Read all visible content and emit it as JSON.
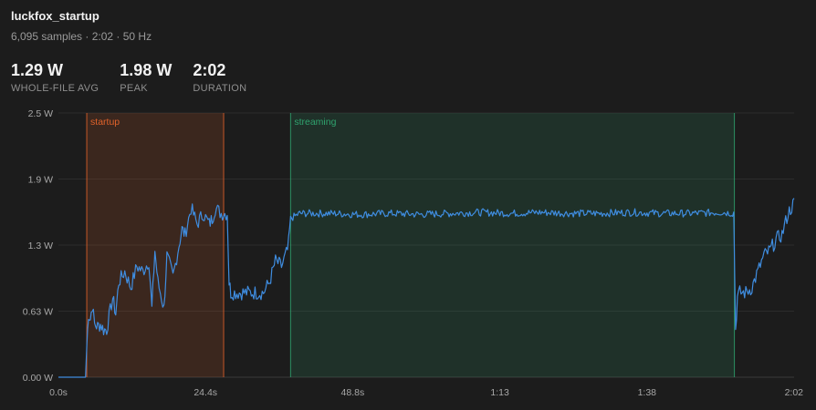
{
  "header": {
    "title": "luckfox_startup",
    "subtitle": "6,095 samples · 2:02 · 50 Hz"
  },
  "stats": [
    {
      "value": "1.29 W",
      "label": "WHOLE-FILE AVG"
    },
    {
      "value": "1.98 W",
      "label": "PEAK"
    },
    {
      "value": "2:02",
      "label": "DURATION"
    }
  ],
  "colors": {
    "line": "#3f8de0",
    "startup": "#e0622a",
    "streaming": "#2fa36e",
    "grid": "#2c2c2c",
    "background": "#1c1c1c"
  },
  "chart_data": {
    "type": "line",
    "xlabel": "",
    "ylabel": "",
    "xlim": [
      0,
      122
    ],
    "ylim": [
      0,
      2.5
    ],
    "x_ticks": [
      {
        "value": 0,
        "label": "0.0s"
      },
      {
        "value": 24.4,
        "label": "24.4s"
      },
      {
        "value": 48.8,
        "label": "48.8s"
      },
      {
        "value": 73.2,
        "label": "1:13"
      },
      {
        "value": 97.6,
        "label": "1:38"
      },
      {
        "value": 122,
        "label": "2:02"
      }
    ],
    "y_ticks": [
      {
        "value": 0,
        "label": "0.00 W"
      },
      {
        "value": 0.625,
        "label": "0.63 W"
      },
      {
        "value": 1.25,
        "label": "1.3 W"
      },
      {
        "value": 1.875,
        "label": "1.9 W"
      },
      {
        "value": 2.5,
        "label": "2.5 W"
      }
    ],
    "grid": true,
    "regions": [
      {
        "label": "startup",
        "start": 4.7,
        "end": 27.4,
        "color": "#e0622a"
      },
      {
        "label": "streaming",
        "start": 38.5,
        "end": 112.1,
        "color": "#2fa36e"
      }
    ],
    "series": [
      {
        "x": [
          0,
          4.5,
          4.7,
          5.0,
          5.3,
          5.6,
          6.0,
          6.5,
          7.0,
          7.5,
          8.0,
          9.0,
          9.5,
          10.0,
          11.0,
          12.0,
          13.0,
          14.0,
          15.0,
          15.5,
          16.0,
          16.5,
          17.5,
          18.0,
          19.0,
          20.0,
          20.5,
          21.0,
          22.0,
          23.0,
          24.0,
          25.0,
          25.5,
          26.0,
          27.0,
          28.0,
          28.3,
          28.6,
          30.0,
          32.0,
          34.0,
          35.0,
          36.0,
          37.0,
          38.0,
          38.5,
          40.0,
          45.0,
          50.0,
          55.0,
          60.0,
          65.0,
          70.0,
          75.0,
          80.0,
          85.0,
          90.0,
          95.0,
          100.0,
          105.0,
          110.0,
          112.0,
          112.3,
          112.6,
          113.0,
          114.0,
          115.0,
          116.0,
          117.0,
          118.0,
          119.0,
          120.0,
          121.0,
          122.0
        ],
        "y": [
          0.0,
          0.0,
          0.3,
          0.6,
          0.55,
          0.68,
          0.5,
          0.48,
          0.5,
          0.45,
          0.45,
          0.75,
          0.6,
          0.9,
          1.0,
          0.85,
          1.05,
          1.0,
          1.1,
          0.65,
          1.2,
          0.9,
          0.65,
          1.15,
          0.95,
          1.25,
          1.4,
          1.35,
          1.6,
          1.45,
          1.55,
          1.45,
          1.5,
          1.6,
          1.55,
          1.55,
          0.9,
          0.8,
          0.8,
          0.8,
          0.8,
          0.9,
          1.1,
          1.05,
          1.2,
          1.5,
          1.55,
          1.55,
          1.54,
          1.55,
          1.54,
          1.55,
          1.56,
          1.55,
          1.56,
          1.55,
          1.55,
          1.56,
          1.55,
          1.55,
          1.56,
          1.55,
          0.45,
          0.75,
          0.8,
          0.8,
          0.85,
          1.0,
          1.15,
          1.2,
          1.3,
          1.35,
          1.55,
          1.65
        ]
      }
    ]
  }
}
